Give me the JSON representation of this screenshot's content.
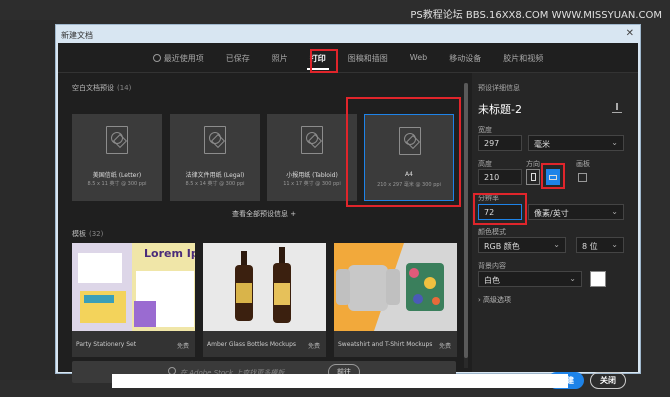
{
  "watermark": "PS教程论坛  BBS.16XX8.COM  WWW.MISSYUAN.COM",
  "window": {
    "title": "新建文档"
  },
  "tabs": [
    {
      "label": "最近使用项"
    },
    {
      "label": "已保存"
    },
    {
      "label": "照片"
    },
    {
      "label": "打印"
    },
    {
      "label": "图稿和插图"
    },
    {
      "label": "Web"
    },
    {
      "label": "移动设备"
    },
    {
      "label": "胶片和视频"
    }
  ],
  "active_tab": "打印",
  "presets_section": {
    "label": "空白文档预设",
    "count": "(14)"
  },
  "presets": [
    {
      "name": "美国信纸 (Letter)",
      "size": "8.5 x 11 英寸 @ 300 ppi"
    },
    {
      "name": "法律文件用纸 (Legal)",
      "size": "8.5 x 14 英寸 @ 300 ppi"
    },
    {
      "name": "小报用纸 (Tabloid)",
      "size": "11 x 17 英寸 @ 300 ppi"
    },
    {
      "name": "A4",
      "size": "210 x 297 毫米 @ 300 ppi"
    }
  ],
  "view_all": "查看全部预设信息 +",
  "templates_section": {
    "label": "模板",
    "count": "(32)"
  },
  "templates": [
    {
      "name": "Party Stationery Set",
      "price": "免费",
      "image_text": "Lorem Ipsum"
    },
    {
      "name": "Amber Glass Bottles Mockups",
      "price": "免费"
    },
    {
      "name": "Sweatshirt and T-Shirt Mockups",
      "price": "免费"
    }
  ],
  "search": {
    "placeholder": "在 Adobe Stock 上查找更多模板",
    "go_label": "前往"
  },
  "panel": {
    "section_title": "预设详细信息",
    "doc_title": "未标题-2",
    "width_label": "宽度",
    "width_value": "297",
    "width_unit": "毫米",
    "height_label": "高度",
    "height_value": "210",
    "orientation_label": "方向",
    "artboard_label": "画板",
    "resolution_label": "分辨率",
    "resolution_value": "72",
    "resolution_unit": "像素/英寸",
    "color_mode_label": "颜色模式",
    "color_mode_value": "RGB 颜色",
    "bit_depth_value": "8 位",
    "background_label": "背景内容",
    "background_value": "白色",
    "advanced_label": "高级选项"
  },
  "buttons": {
    "create": "创建",
    "close": "关闭"
  },
  "colors": {
    "accent": "#1e83e8",
    "highlight": "#e0252b"
  }
}
